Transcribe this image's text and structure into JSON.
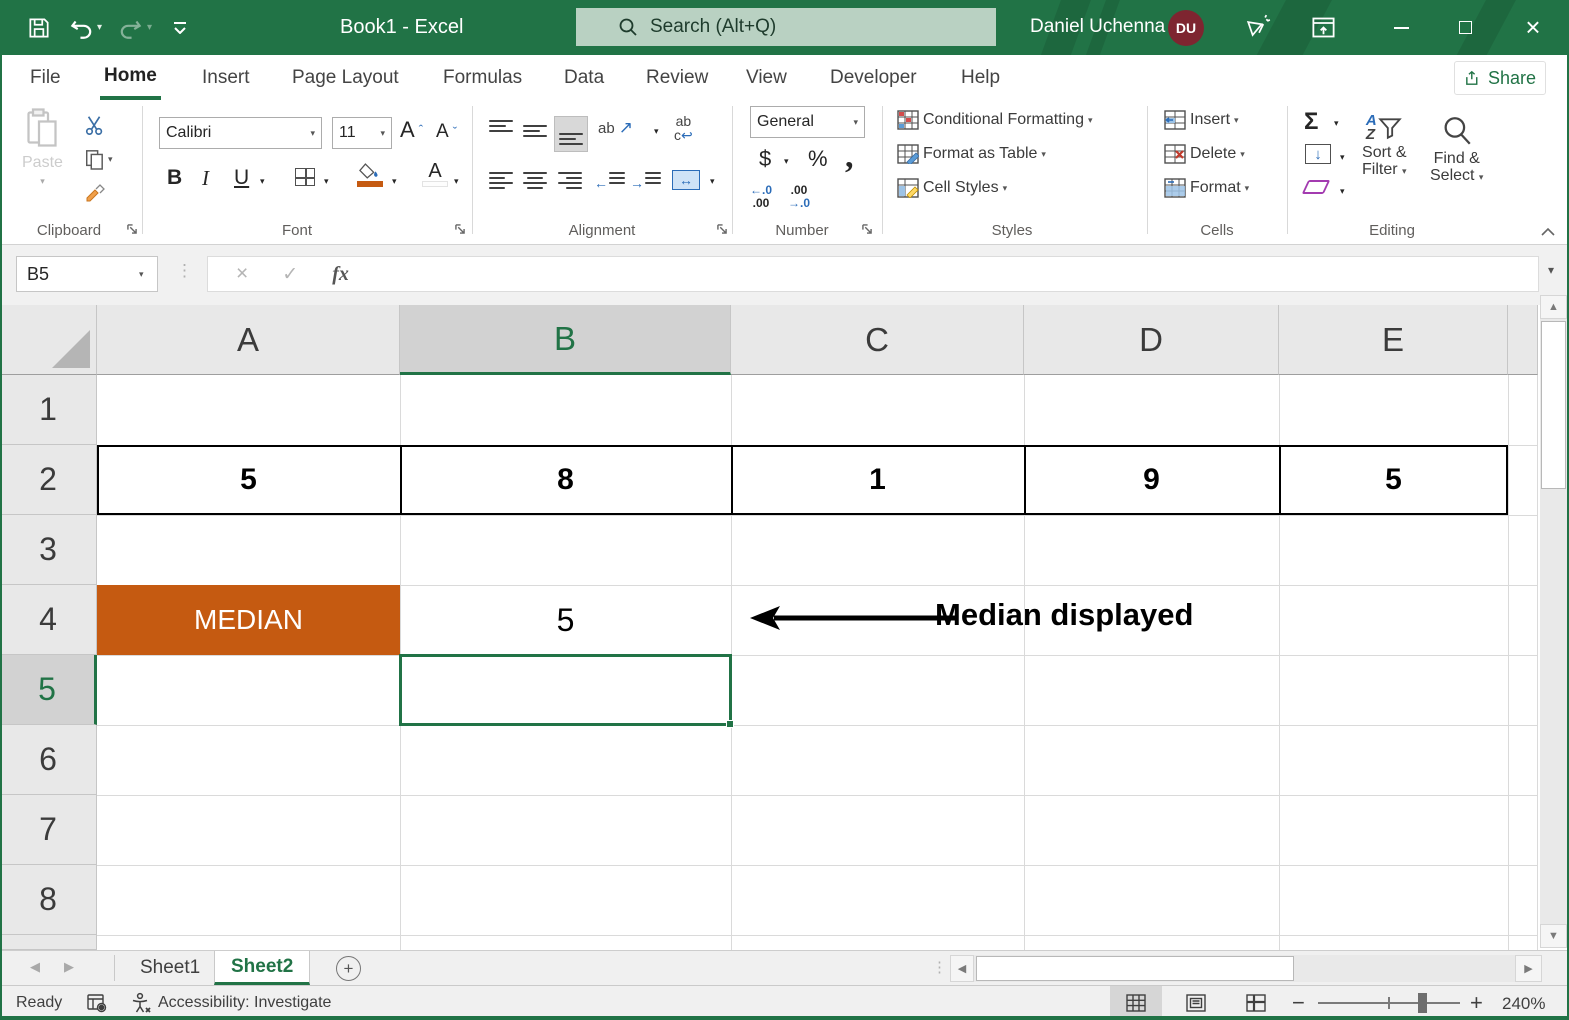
{
  "colors": {
    "green": "#217346",
    "orange": "#C55A11",
    "avatar": "#7E2530",
    "search_bg": "#B9D1C2",
    "active_cell_border": "#217346"
  },
  "icons": {
    "dropdown": "▾",
    "up_scroll": "▲",
    "down_scroll": "▼",
    "left_scroll": "◀",
    "right_scroll": "▶",
    "plus": "+",
    "minus": "−",
    "close": "×",
    "cancel": "×",
    "check": "✓",
    "ellipsis": "⋮",
    "caret_up": "ˆ",
    "caret_down": "ˇ",
    "arrow_up_right": "↗",
    "arrow_return": "↩",
    "arrow_left_right": "↔",
    "arrow_down": "↓",
    "arrow_left": "←",
    "arrow_right": "→"
  },
  "title_bar": {
    "title": "Book1 - Excel",
    "search": "Search (Alt+Q)",
    "user": "Daniel Uchenna",
    "initials": "DU"
  },
  "tabs": {
    "items": [
      "File",
      "Home",
      "Insert",
      "Page Layout",
      "Formulas",
      "Data",
      "Review",
      "View",
      "Developer",
      "Help"
    ],
    "share": "Share"
  },
  "ribbon": {
    "clipboard": {
      "name": "Clipboard",
      "paste": "Paste"
    },
    "font": {
      "name": "Font",
      "family": "Calibri",
      "size": "11",
      "bold": "B",
      "italic": "I",
      "underline": "U",
      "color_a": "A",
      "grow": "A",
      "shrink": "A"
    },
    "alignment": {
      "name": "Alignment",
      "wrap_top": "ab",
      "wrap_bottom": "c",
      "orient": "ab"
    },
    "number": {
      "name": "Number",
      "format": "General",
      "currency": "$",
      "percent": "%",
      "comma": ",",
      "inc1": "←.0",
      "inc2": ".00",
      "dec1": ".00",
      "dec2": "→.0"
    },
    "styles": {
      "name": "Styles",
      "conditional": "Conditional Formatting",
      "table": "Format as Table",
      "cell_styles": "Cell Styles"
    },
    "cells": {
      "name": "Cells",
      "insert": "Insert",
      "delete": "Delete",
      "format": "Format"
    },
    "editing": {
      "name": "Editing",
      "autosum": "Σ",
      "sort1": "Sort &",
      "sort2": "Filter",
      "find1": "Find &",
      "find2": "Select",
      "a": "A",
      "z": "Z"
    }
  },
  "formula_bar": {
    "name_box": "B5",
    "fx": "fx",
    "value": ""
  },
  "grid": {
    "columns": [
      "A",
      "B",
      "C",
      "D",
      "E"
    ],
    "rows": [
      "1",
      "2",
      "3",
      "4",
      "5",
      "6",
      "7",
      "8"
    ],
    "row2": [
      "5",
      "8",
      "1",
      "9",
      "5"
    ],
    "a4": "MEDIAN",
    "b4": "5",
    "annotation": "Median displayed"
  },
  "sheet_tabs": {
    "sheet1": "Sheet1",
    "sheet2": "Sheet2"
  },
  "status_bar": {
    "mode": "Ready",
    "accessibility": "Accessibility: Investigate",
    "zoom": "240%"
  }
}
